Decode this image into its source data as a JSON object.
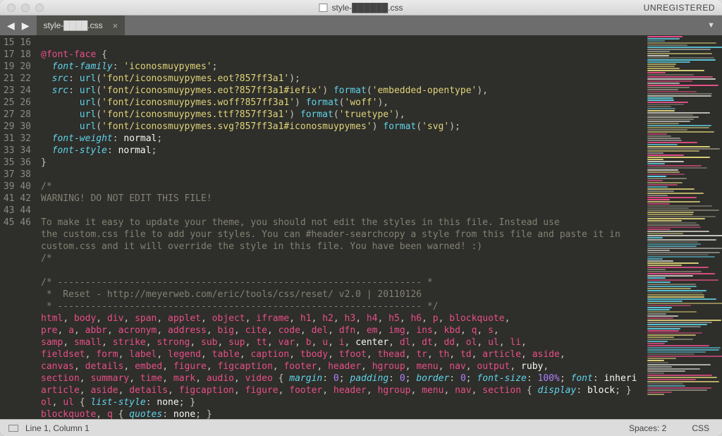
{
  "titlebar": {
    "filename": "style-██████.css",
    "rightLabel": "UNREGISTERED"
  },
  "tab": {
    "filename": "style-████.css"
  },
  "status": {
    "position": "Line 1, Column 1",
    "spaces": "Spaces: 2",
    "syntax": "CSS"
  },
  "gutter": {
    "start": 15,
    "end": 46
  },
  "code": {
    "l15": "",
    "l16_at": "@font-face",
    "l16_brace": " {",
    "l17_prop": "font-family",
    "l17_val": "'iconosmuypymes'",
    "l18_prop": "src",
    "l18_fn": "url",
    "l18_str": "'font/iconosmuypymes.eot?857ff3a1'",
    "l19_prop": "src",
    "l19_url": "url",
    "l19_s1": "'font/iconosmuypymes.eot?857ff3a1#iefix'",
    "l19_fmt": "format",
    "l19_s2": "'embedded-opentype'",
    "l20_s1": "'font/iconosmuypymes.woff?857ff3a1'",
    "l20_s2": "'woff'",
    "l21_s1": "'font/iconosmuypymes.ttf?857ff3a1'",
    "l21_s2": "'truetype'",
    "l22_s1": "'font/iconosmuypymes.svg?857ff3a1#iconosmuypymes'",
    "l22_s2": "'svg'",
    "l23_prop": "font-weight",
    "l23_val": "normal",
    "l24_prop": "font-style",
    "l24_val": "normal",
    "l25": "}",
    "l27": "/*",
    "l28": "WARNING! DO NOT EDIT THIS FILE!",
    "l30": "To make it easy to update your theme, you should not edit the styles in this file. Instead use",
    "l31": "the custom.css file to add your styles. You can #header-searchcopy a style from this file and paste it in",
    "l32": "custom.css and it will override the style in this file. You have been warned! :)",
    "l33": "/*",
    "l35": "/* ------------------------------------------------------------------ *",
    "l36": " *  Reset - http://meyerweb.com/eric/tools/css/reset/ v2.0 | 20110126",
    "l37": " * ------------------------------------------------------------------ */",
    "l38_a": "html",
    "l38_b": "body",
    "l38_c": "div",
    "l38_d": "span",
    "l38_e": "applet",
    "l38_f": "object",
    "l38_g": "iframe",
    "l38_h": "h1",
    "l38_i": "h2",
    "l38_j": "h3",
    "l38_k": "h4",
    "l38_l": "h5",
    "l38_m": "h6",
    "l38_n": "p",
    "l38_o": "blockquote",
    "l39_a": "pre",
    "l39_b": "a",
    "l39_c": "abbr",
    "l39_d": "acronym",
    "l39_e": "address",
    "l39_f": "big",
    "l39_g": "cite",
    "l39_h": "code",
    "l39_i": "del",
    "l39_j": "dfn",
    "l39_k": "em",
    "l39_l": "img",
    "l39_m": "ins",
    "l39_n": "kbd",
    "l39_o": "q",
    "l39_p": "s",
    "l40_a": "samp",
    "l40_b": "small",
    "l40_c": "strike",
    "l40_d": "strong",
    "l40_e": "sub",
    "l40_f": "sup",
    "l40_g": "tt",
    "l40_h": "var",
    "l40_i": "b",
    "l40_j": "u",
    "l40_k": "i",
    "l40_l": "center",
    "l40_m": "dl",
    "l40_n": "dt",
    "l40_o": "dd",
    "l40_p": "ol",
    "l40_q": "ul",
    "l40_r": "li",
    "l41_a": "fieldset",
    "l41_b": "form",
    "l41_c": "label",
    "l41_d": "legend",
    "l41_e": "table",
    "l41_f": "caption",
    "l41_g": "tbody",
    "l41_h": "tfoot",
    "l41_i": "thead",
    "l41_j": "tr",
    "l41_k": "th",
    "l41_l": "td",
    "l41_m": "article",
    "l41_n": "aside",
    "l42_a": "canvas",
    "l42_b": "details",
    "l42_c": "embed",
    "l42_d": "figure",
    "l42_e": "figcaption",
    "l42_f": "footer",
    "l42_g": "header",
    "l42_h": "hgroup",
    "l42_i": "menu",
    "l42_j": "nav",
    "l42_k": "output",
    "l42_l": "ruby",
    "l43_a": "section",
    "l43_b": "summary",
    "l43_c": "time",
    "l43_d": "mark",
    "l43_e": "audio",
    "l43_f": "video",
    "l43_p1": "margin",
    "l43_v1": "0",
    "l43_p2": "padding",
    "l43_v2": "0",
    "l43_p3": "border",
    "l43_v3": "0",
    "l43_p4": "font-size",
    "l43_v4": "100%",
    "l43_p5": "font",
    "l43_v5": "inheri",
    "l44_a": "article",
    "l44_b": "aside",
    "l44_c": "details",
    "l44_d": "figcaption",
    "l44_e": "figure",
    "l44_f": "footer",
    "l44_g": "header",
    "l44_h": "hgroup",
    "l44_i": "menu",
    "l44_j": "nav",
    "l44_k": "section",
    "l44_p": "display",
    "l44_v": "block",
    "l45_a": "ol",
    "l45_b": "ul",
    "l45_p": "list-style",
    "l45_v": "none",
    "l46_a": "blockquote",
    "l46_b": "q",
    "l46_p": "quotes",
    "l46_v": "none"
  }
}
